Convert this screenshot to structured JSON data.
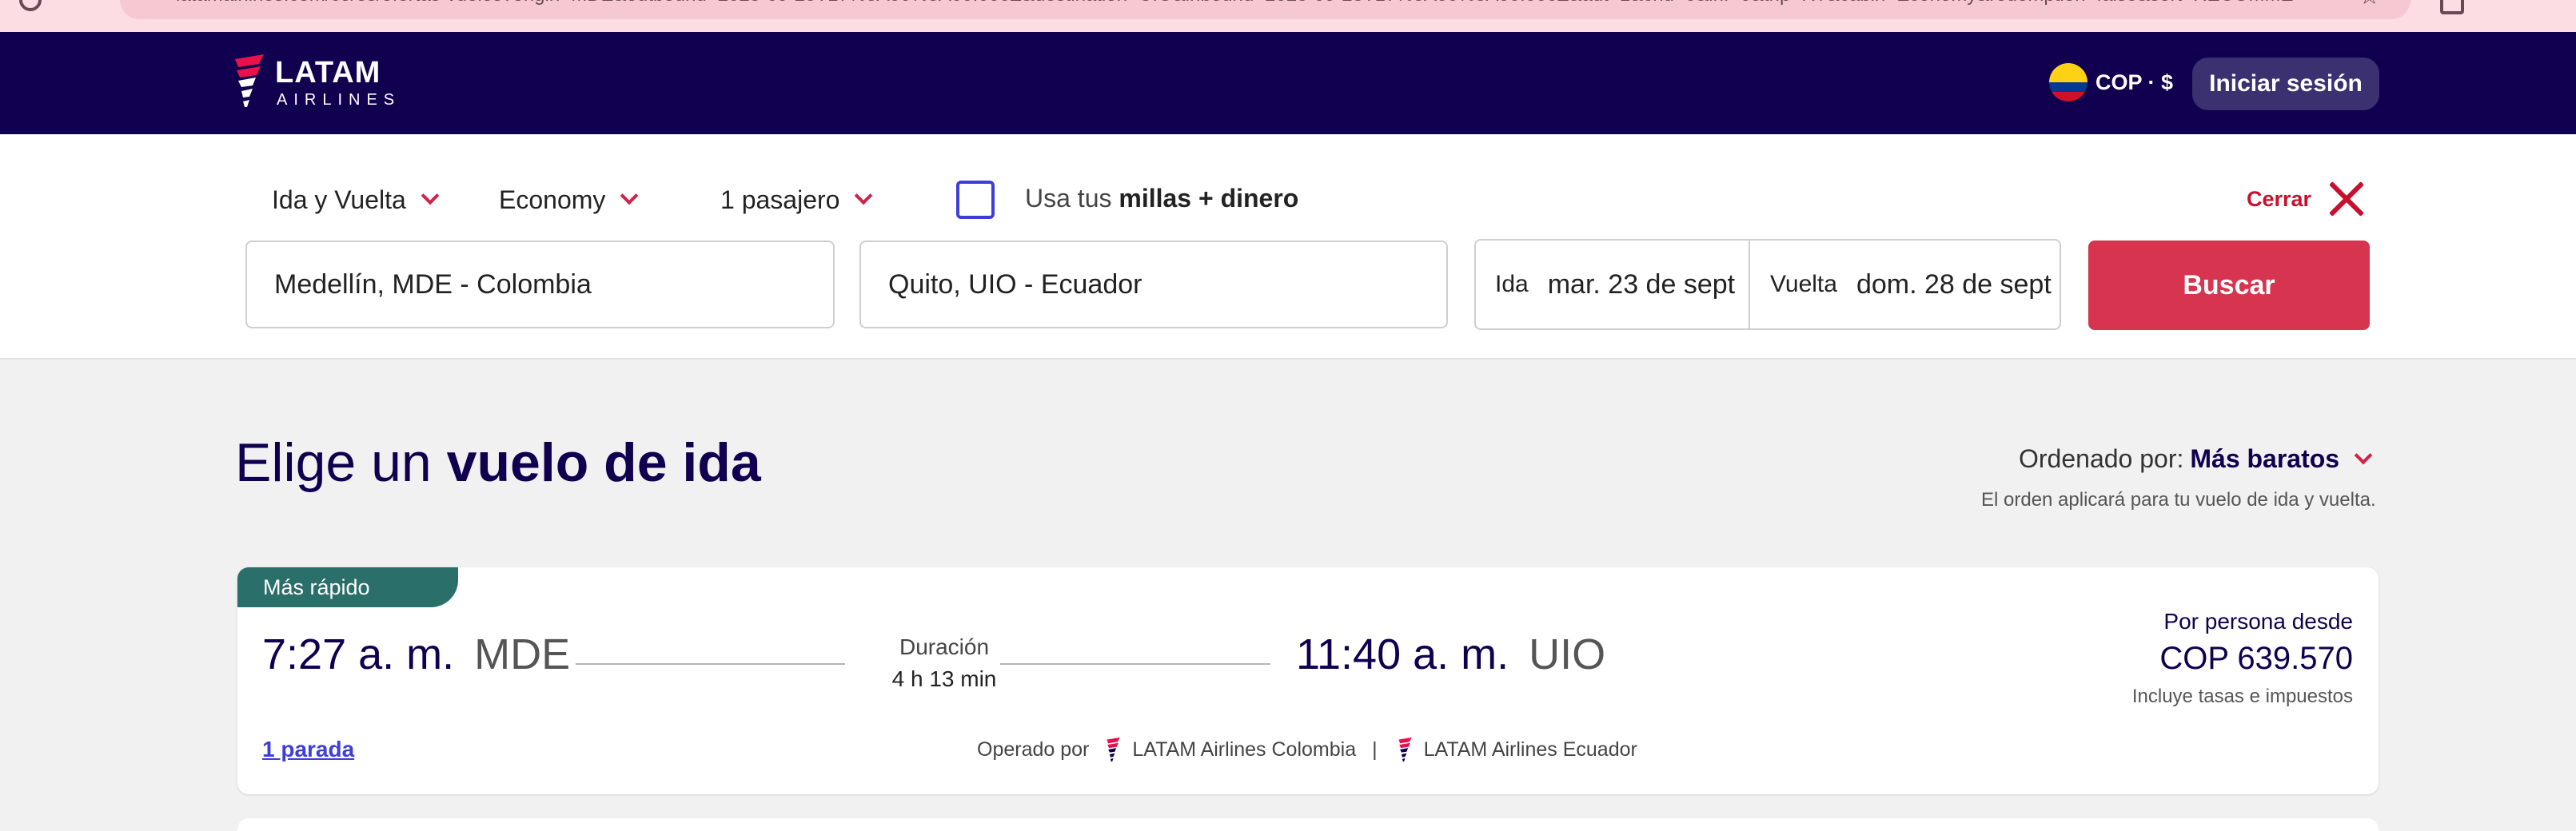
{
  "browser": {
    "url": "latamairlines.com/co/es/ofertas-vuelos?origin=MDE&outbound=2025-09-23T17%3A00%3A00.000Z&destination=UIO&inbound=2025-09-28T17%3A00%3A00.000Z&adt=1&chd=0&inf=0&trip=RT&cabin=Economy&redemption=false&sort=RECOMMENDED"
  },
  "header": {
    "brand_name": "LATAM",
    "brand_sub": "AIRLINES",
    "currency_label": "COP · $",
    "login_label": "Iniciar sesión",
    "colors": {
      "background": "#10004f",
      "brand_red": "#e8114b"
    }
  },
  "search": {
    "trip_type": "Ida y Vuelta",
    "cabin": "Economy",
    "passengers": "1 pasajero",
    "miles_prefix": "Usa tus",
    "miles_bold": "millas + dinero",
    "miles_checked": false,
    "close_label": "Cerrar",
    "origin": "Medellín, MDE - Colombia",
    "destination": "Quito, UIO - Ecuador",
    "depart_label": "Ida",
    "depart_value": "mar. 23 de sept",
    "return_label": "Vuelta",
    "return_value": "dom. 28 de sept",
    "search_button": "Buscar",
    "accent_color": "#d7344f"
  },
  "results": {
    "title_light": "Elige un",
    "title_bold": "vuelo de ida",
    "sort_label": "Ordenado por:",
    "sort_value": "Más baratos",
    "sort_note": "El orden aplicará para tu vuelo de ida y vuelta.",
    "flights": [
      {
        "badge": "Más rápido",
        "depart_time": "7:27 a. m.",
        "depart_code": "MDE",
        "duration_label": "Duración",
        "duration": "4 h 13 min",
        "arrive_time": "11:40 a. m.",
        "arrive_code": "UIO",
        "price_label": "Por persona desde",
        "price": "COP 639.570",
        "price_note": "Incluye tasas e impuestos",
        "stops": "1 parada",
        "operated_by_label": "Operado por",
        "operators": [
          "LATAM Airlines Colombia",
          "LATAM Airlines Ecuador"
        ],
        "operator_separator": "|"
      }
    ]
  }
}
